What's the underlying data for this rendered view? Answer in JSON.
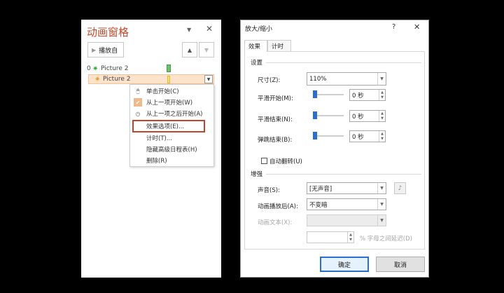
{
  "animation_pane": {
    "title": "动画窗格",
    "play_button": "播放自",
    "dropdown_glyph": "▼",
    "close_glyph": "✕",
    "up_glyph": "▲",
    "down_glyph": "▼",
    "items": [
      {
        "number": "0",
        "name": "Picture 2"
      },
      {
        "number": "",
        "name": "Picture 2"
      }
    ],
    "context_menu": {
      "items": [
        {
          "label": "单击开始(C)",
          "icon": "mouse-icon"
        },
        {
          "label": "从上一项开始(W)",
          "icon": "check-icon",
          "checked": true
        },
        {
          "label": "从上一项之后开始(A)",
          "icon": "clock-icon"
        },
        {
          "label": "效果选项(E)...",
          "icon": ""
        },
        {
          "label": "计时(T)...",
          "icon": ""
        },
        {
          "label": "隐藏高级日程表(H)",
          "icon": ""
        },
        {
          "label": "删除(R)",
          "icon": ""
        }
      ]
    }
  },
  "dialog": {
    "title": "放大/缩小",
    "help_glyph": "?",
    "close_glyph": "✕",
    "tabs": [
      {
        "label": "效果",
        "active": true
      },
      {
        "label": "计时",
        "active": false
      }
    ],
    "settings": {
      "section": "设置",
      "size_label": "尺寸(Z):",
      "size_value": "110%",
      "smooth_start_label": "平滑开始(M):",
      "smooth_start_value": "0 秒",
      "smooth_end_label": "平滑结束(N):",
      "smooth_end_value": "0 秒",
      "bounce_end_label": "弹跳结束(B):",
      "bounce_end_value": "0 秒",
      "auto_reverse_label": "自动翻转(U)",
      "auto_reverse_checked": false
    },
    "enhance": {
      "section": "增强",
      "sound_label": "声音(S):",
      "sound_value": "[无声音]",
      "after_anim_label": "动画播放后(A):",
      "after_anim_value": "不变暗",
      "anim_text_label": "动画文本(X):",
      "anim_text_value": "",
      "delay_value": "",
      "delay_suffix": "% 字母之间延迟(D)"
    },
    "ok_button": "确定",
    "cancel_button": "取消"
  }
}
